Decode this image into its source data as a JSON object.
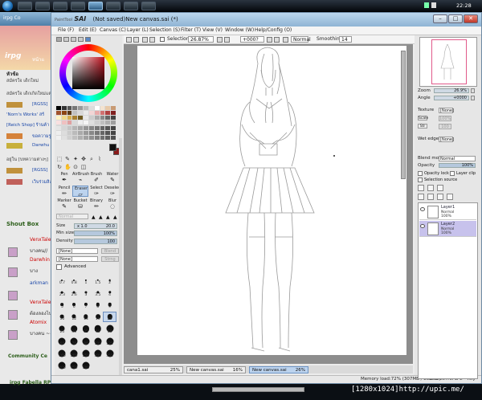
{
  "taskbar": {
    "clock": "22:28",
    "buttons": [
      "ie",
      "folder",
      "media",
      "firefox",
      "sai",
      "photo",
      "msn",
      "other"
    ]
  },
  "browser": {
    "tab_title": "irpg Co",
    "logo": "irpg",
    "site_title": "หน้าแ",
    "sidebar_heading": "หัวข้อ",
    "lines": [
      "สมัครใจ เด็กใหม่",
      "สมัครใจ เด็กเกิดใหม่แต่",
      "[RGSS]",
      "'Norn's Works' สร้",
      "[Reich Shop] ร้านค้า",
      "ขอความรู",
      "Darwhu",
      "อยู่ใน [บทความต่างๆ]",
      "[RGSS]",
      "เว็บร่วมสิ่ง"
    ],
    "shout_box": "Shout Box",
    "users": [
      "VenxTale",
      "Darwhin",
      "arkman",
      "VenxTale",
      "Atomix"
    ],
    "user_messages": [
      "บางคน//",
      "บาง",
      "",
      "ต้องลองไป",
      "บางคน ~~"
    ],
    "community": "Community Ce",
    "fabella": "irpg Fabella RP"
  },
  "sai": {
    "app_name": "SAI",
    "brand_prefix": "PaintTool",
    "doc_status": "(Not saved)New canvas.sai (*)",
    "menu": [
      "File (F)",
      "Edit (E)",
      "Canvas (C)",
      "Layer (L)",
      "Selection (S)",
      "Filter (T)",
      "View (V)",
      "Window (W)",
      "Help/Config (O)"
    ],
    "toolbar": {
      "selection_label": "Selection",
      "zoom": "26.87%",
      "rotation": "+000?",
      "blend": "Normal",
      "smoothing_label": "Smoothing",
      "smoothing_value": "14"
    },
    "tools": {
      "rows": [
        [
          "Pen",
          "AirBrush",
          "Brush",
          "Water"
        ],
        [
          "Pencil",
          "Eraser",
          "Select",
          "Deselect"
        ],
        [
          "Marker",
          "Bucket",
          "Binary",
          "Blur"
        ]
      ]
    },
    "brush_props": {
      "mode": "Normal",
      "size_label": "Size",
      "size_mult": "x 1.0",
      "size_value": "20.0",
      "min_size_label": "Min size",
      "min_size_value": "100%",
      "min_size_frac": 1.0,
      "density_label": "Density",
      "density_value": "100",
      "density_frac": 1.0,
      "texture": "[None]",
      "texture_ghost": "Blend",
      "texture2": "[None]",
      "texture2_ghost": "Strng",
      "advanced": "Advanced"
    },
    "brush_sizes": [
      "0.7",
      "0.8",
      "1",
      "1.5",
      "2",
      "2.3",
      "2.6",
      "3",
      "3.5",
      "4",
      "5",
      "6",
      "7",
      "8",
      "9",
      "10",
      "12",
      "14",
      "16",
      "20",
      "25",
      "30",
      "35",
      "40",
      "50",
      "60",
      "70",
      "80",
      "100",
      "120",
      "160",
      "200",
      "250",
      "300",
      "350",
      "400",
      "450",
      "500"
    ],
    "brush_selected": "20",
    "right_panel": {
      "zoom_label": "Zoom",
      "zoom_value": "26.9%",
      "angle_label": "Angle",
      "angle_value": "+0000",
      "texture_label": "Texture",
      "texture_value": "[None]",
      "texture_scale": "Scale",
      "texture_scale_value": "100%",
      "texture_strength": "Str",
      "texture_strength_value": "100",
      "wetedge_label": "Wet edge",
      "wetedge_value": "[None]",
      "blend_label": "Blend mode",
      "blend_value": "Normal",
      "opacity_label": "Opacity",
      "opacity_value": "100%",
      "opacity_frac": 1.0,
      "opacity_lock": "Opacity lock",
      "layer_clip": "Layer clip",
      "selection_source": "Selection source"
    },
    "layers": [
      {
        "name": "Layer1",
        "mode": "Normal",
        "opacity": "100%",
        "selected": false
      },
      {
        "name": "Layer2",
        "mode": "Normal",
        "opacity": "100%",
        "selected": true
      }
    ],
    "doc_tabs": [
      {
        "name": "cana1.sai",
        "zoom": "25%"
      },
      {
        "name": "New canvas.sai",
        "zoom": "16%"
      },
      {
        "name": "New canvas.sai",
        "zoom": "26%"
      }
    ],
    "status": "Memory load:72% (307MB / 858MB)",
    "status_keys": "Shift Ctrl Alt SPC",
    "status_tail": "Any"
  },
  "watermark": "[1280x1024]http://upic.me/"
}
